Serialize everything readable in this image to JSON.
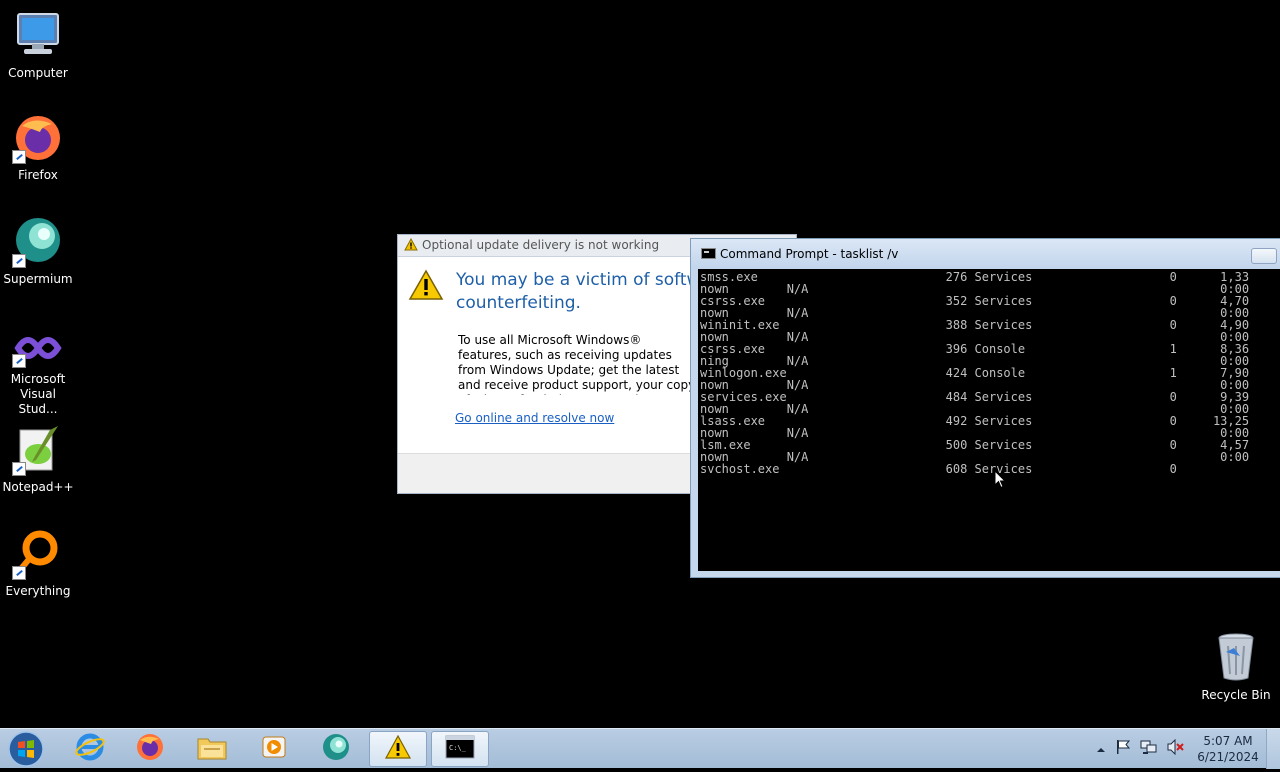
{
  "desktop": {
    "icons": [
      {
        "label": "Computer"
      },
      {
        "label": "Firefox"
      },
      {
        "label": "Supermium"
      },
      {
        "label": "Microsoft\nVisual Stud..."
      },
      {
        "label": "Notepad++"
      },
      {
        "label": "Everything"
      },
      {
        "label": "Recycle Bin"
      }
    ]
  },
  "warning_dialog": {
    "title": "Optional update delivery is not working",
    "headline": "You may be a victim of software counterfeiting.",
    "body": "To use all Microsoft Windows® features, such as receiving updates from Windows Update; get the latest and receive product support, your copy of Microsoft Windows® must be validated as genuine.",
    "link": "Go online and resolve now"
  },
  "command_prompt": {
    "title": "Command Prompt - tasklist  /v",
    "lines": [
      "smss.exe                          276 Services                   0      1,33",
      "nown        N/A                                                         0:00",
      "csrss.exe                         352 Services                   0      4,70",
      "nown        N/A                                                         0:00",
      "wininit.exe                       388 Services                   0      4,90",
      "nown        N/A                                                         0:00",
      "csrss.exe                         396 Console                    1      8,36",
      "ning        N/A                                                         0:00",
      "winlogon.exe                      424 Console                    1      7,90",
      "nown        N/A                                                         0:00",
      "services.exe                      484 Services                   0      9,39",
      "nown        N/A                                                         0:00",
      "lsass.exe                         492 Services                   0     13,25",
      "nown        N/A                                                         0:00",
      "lsm.exe                           500 Services                   0      4,57",
      "nown        N/A                                                         0:00",
      "svchost.exe                       608 Services                   0"
    ]
  },
  "taskbar": {
    "pinned": [
      {
        "icon": "internet-explorer-icon"
      },
      {
        "icon": "firefox-icon"
      },
      {
        "icon": "file-explorer-icon"
      },
      {
        "icon": "media-player-icon"
      },
      {
        "icon": "supermium-icon"
      },
      {
        "icon": "warning-icon",
        "active": true
      },
      {
        "icon": "command-prompt-icon",
        "active": true
      }
    ],
    "clock": {
      "time": "5:07 AM",
      "date": "6/21/2024"
    }
  }
}
